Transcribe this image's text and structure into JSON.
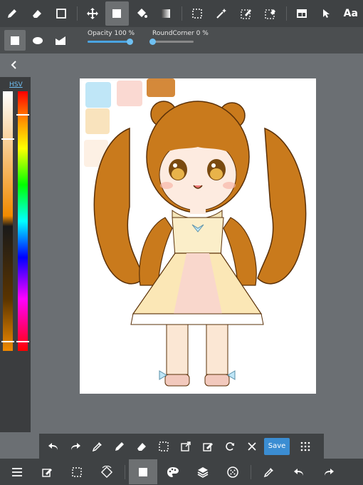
{
  "toolbar": {
    "tools": [
      {
        "icon": "pen-icon"
      },
      {
        "icon": "eraser-icon"
      },
      {
        "icon": "rectangle-outline-icon"
      },
      {
        "icon": "move-icon"
      },
      {
        "icon": "fill-shape-icon",
        "active": true
      },
      {
        "icon": "bucket-icon"
      },
      {
        "icon": "gradient-icon"
      },
      {
        "icon": "select-rect-icon"
      },
      {
        "icon": "magic-wand-icon"
      },
      {
        "icon": "select-pen-icon"
      },
      {
        "icon": "select-eraser-icon"
      },
      {
        "icon": "layout-icon"
      },
      {
        "icon": "cursor-icon"
      }
    ],
    "text_tool_label": "Aa"
  },
  "shape_options": {
    "shapes": [
      "rectangle-icon",
      "ellipse-icon",
      "polygon-icon"
    ],
    "active_shape": "rectangle-icon",
    "opacity_label": "Opacity",
    "opacity_value": "100 %",
    "opacity_fraction": 1.0,
    "roundcorner_label": "RoundCorner",
    "roundcorner_value": "0 %",
    "roundcorner_fraction": 0.0
  },
  "color_panel": {
    "mode_label": "HSV",
    "current_color": "#d98a18"
  },
  "palette_swatches": [
    "#bfe6f7",
    "#fad9d2",
    "#d4893a",
    "#f9e3bd",
    "#fdf0e4"
  ],
  "bottom_bar": {
    "save_label": "Save",
    "icons": [
      "undo-icon",
      "redo-icon",
      "eyedropper-icon",
      "pen-icon",
      "eraser-icon",
      "select-rect-icon",
      "transform-icon",
      "edit-icon",
      "rotate-icon",
      "close-icon"
    ]
  },
  "main_bar": {
    "icons": [
      "menu-icon",
      "edit-icon",
      "select-icon",
      "rotate-canvas-icon",
      "brush-color-icon",
      "palette-icon",
      "layers-icon",
      "material-icon",
      "eyedropper-icon",
      "undo-icon",
      "redo-icon"
    ],
    "active": "brush-color-icon"
  },
  "colors": {
    "accent": "#3b8dd2",
    "toolbar_bg": "#3f4244",
    "workspace_bg": "#6b6f73"
  }
}
